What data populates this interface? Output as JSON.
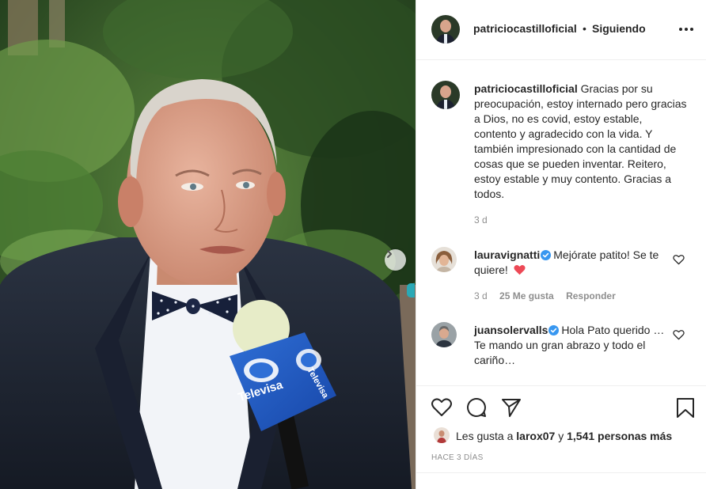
{
  "post": {
    "username": "patriciocastilloficial",
    "separator": "•",
    "follow_status": "Siguiendo",
    "caption": "Gracias por su preocupación, estoy internado pero gracias a Dios, no es covid, estoy estable, contento y agradecido con la vida. Y también impresionado con la cantidad de cosas que se pueden inventar. Reitero, estoy estable y muy contento. Gracias a todos.",
    "caption_time": "3 d"
  },
  "photo": {
    "mic_brand": "Televisa"
  },
  "comments": [
    {
      "username": "lauravignatti",
      "verified": true,
      "text": "Mejórate patito! Se te quiere!",
      "emoji": "heart",
      "time": "3 d",
      "likes": "25 Me gusta",
      "reply": "Responder"
    },
    {
      "username": "juansolervalls",
      "verified": true,
      "text": "Hola Pato querido … Te mando un gran abrazo y todo el cariño…"
    }
  ],
  "likes_bar": {
    "prefix": "Les gusta a",
    "first_liker": "larox07",
    "joiner": "y",
    "others": "1,541 personas más",
    "posted": "HACE 3 DÍAS"
  },
  "colors": {
    "accent_verified": "#3897f0",
    "heart_red": "#ed4956",
    "muted": "#8e8e8e",
    "text": "#262626"
  }
}
